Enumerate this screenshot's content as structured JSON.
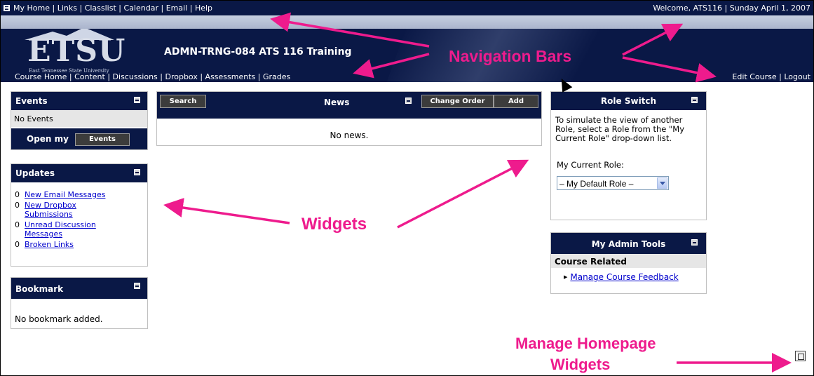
{
  "top_nav": {
    "links": [
      "My Home",
      "Links",
      "Classlist",
      "Calendar",
      "Email",
      "Help"
    ],
    "welcome": "Welcome, ATS116",
    "date": "Sunday April 1, 2007"
  },
  "banner": {
    "logo_text": "ETSU",
    "logo_subtitle": "East Tennessee State University",
    "course_title": "ADMN-TRNG-084 ATS 116 Training"
  },
  "course_nav": {
    "links": [
      "Course Home",
      "Content",
      "Discussions",
      "Dropbox",
      "Assessments",
      "Grades"
    ],
    "right_links": [
      "Edit Course",
      "Logout"
    ]
  },
  "events": {
    "title": "Events",
    "empty": "No Events",
    "open_label": "Open my",
    "button": "Events"
  },
  "updates": {
    "title": "Updates",
    "items": [
      {
        "count": "0",
        "label": "New Email Messages"
      },
      {
        "count": "0",
        "label": "New Dropbox Submissions"
      },
      {
        "count": "0",
        "label": "Unread Discussion Messages"
      },
      {
        "count": "0",
        "label": "Broken Links"
      }
    ]
  },
  "bookmark": {
    "title": "Bookmark",
    "empty": "No bookmark added."
  },
  "news": {
    "search_button": "Search",
    "title": "News",
    "change_order_button": "Change Order",
    "add_button": "Add",
    "empty": "No news."
  },
  "role_switch": {
    "title": "Role Switch",
    "description": "To simulate the view of another Role, select a Role from the \"My Current Role\" drop-down list.",
    "label": "My Current Role:",
    "selected": "– My Default Role –"
  },
  "admin_tools": {
    "title": "My Admin Tools",
    "section": "Course Related",
    "link": "Manage Course Feedback"
  },
  "annotations": {
    "navigation_bars": "Navigation Bars",
    "widgets": "Widgets",
    "manage_homepage_line1": "Manage Homepage",
    "manage_homepage_line2": "Widgets"
  },
  "colors": {
    "navy": "#0a1846",
    "annotation": "#ee1b8d",
    "link": "#0000cc"
  }
}
